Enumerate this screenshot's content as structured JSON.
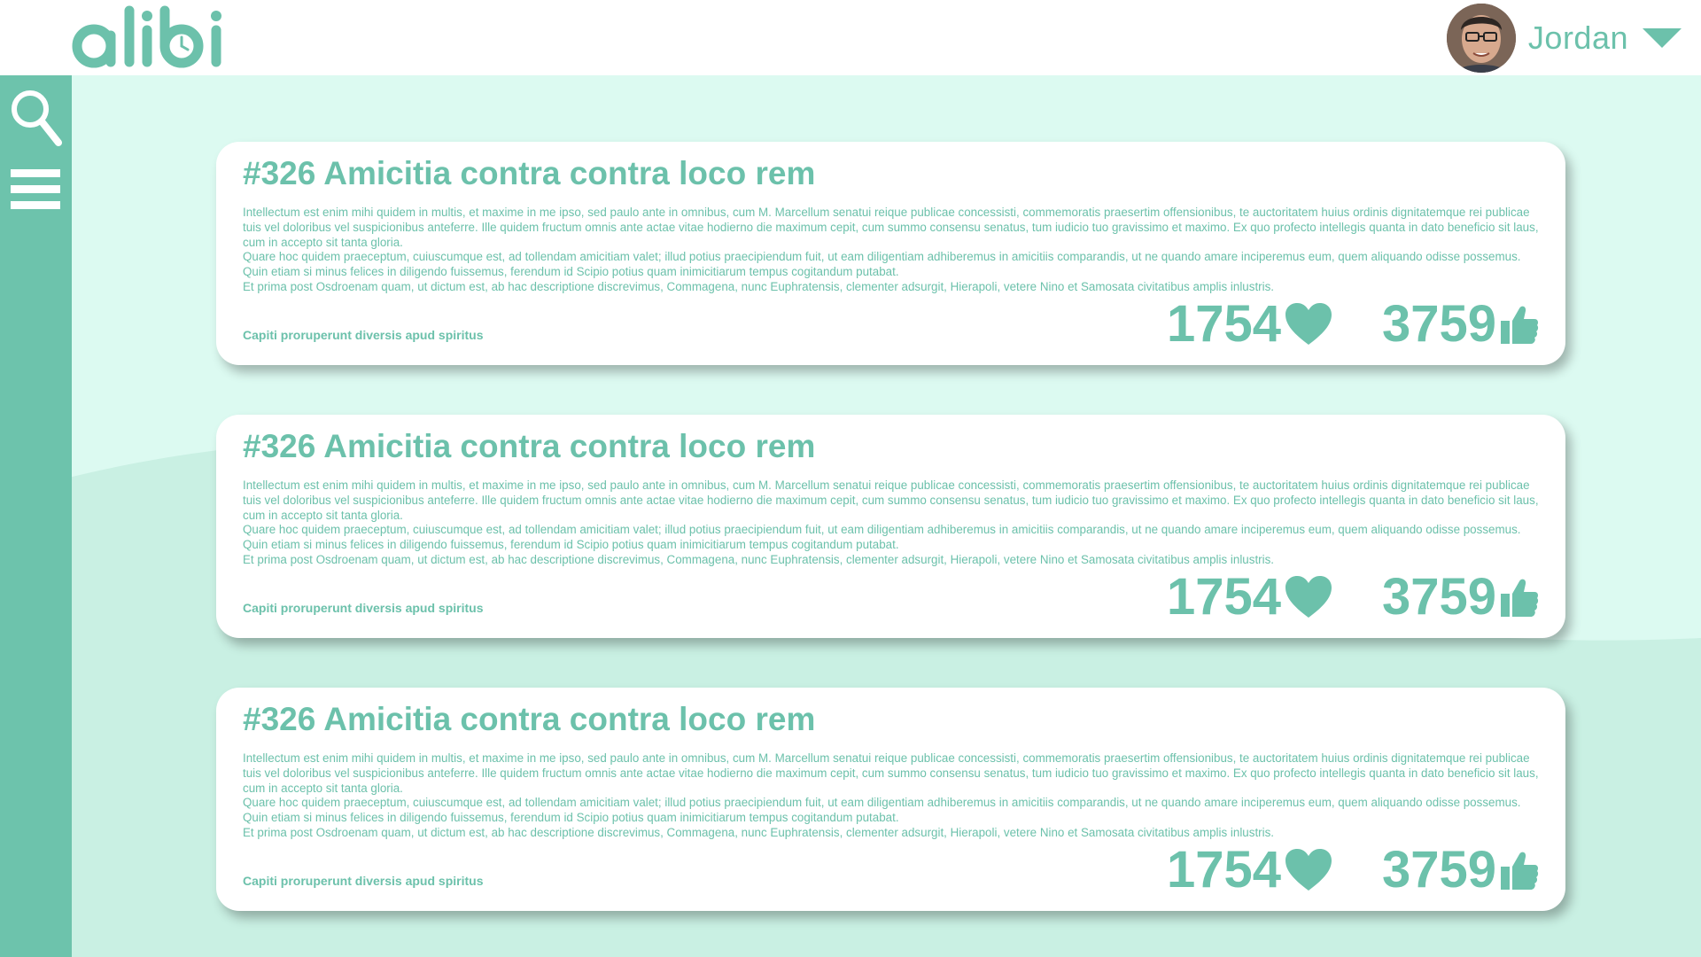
{
  "colors": {
    "accent": "#6cc1ab",
    "sidebar": "#6dc3ac",
    "background": "#dcfaf1",
    "card": "#ffffff"
  },
  "header": {
    "logo_text": "alibi",
    "user": {
      "name": "Jordan",
      "avatar_icon": "user-avatar",
      "menu_icon": "chevron-down-icon"
    }
  },
  "sidebar": {
    "icons": [
      "search-icon",
      "menu-icon"
    ]
  },
  "cards": [
    {
      "title": "#326 Amicitia contra contra loco rem",
      "paragraphs": [
        "Intellectum est enim mihi quidem in multis, et maxime in me ipso, sed paulo ante in omnibus, cum M. Marcellum senatui reique publicae concessisti, commemoratis praesertim offensionibus, te auctoritatem huius ordinis dignitatemque rei publicae tuis vel doloribus vel suspicionibus anteferre. Ille quidem fructum omnis ante actae vitae hodierno die maximum cepit, cum summo consensu senatus, tum iudicio tuo gravissimo et maximo. Ex quo profecto intellegis quanta in dato beneficio sit laus, cum in accepto sit tanta gloria.",
        "Quare hoc quidem praeceptum, cuiuscumque est, ad tollendam amicitiam valet; illud potius praecipiendum fuit, ut eam diligentiam adhiberemus in amicitiis comparandis, ut ne quando amare inciperemus eum, quem aliquando odisse possemus. Quin etiam si minus felices in diligendo fuissemus, ferendum id Scipio potius quam inimicitiarum tempus cogitandum putabat.",
        "Et prima post Osdroenam quam, ut dictum est, ab hac descriptione discrevimus, Commagena, nunc Euphratensis, clementer adsurgit, Hierapoli, vetere Nino et Samosata civitatibus amplis inlustris."
      ],
      "tag": "Capiti proruperunt diversis apud spiritus",
      "hearts": "1754",
      "likes": "3759"
    },
    {
      "title": "#326 Amicitia contra contra loco rem",
      "paragraphs": [
        "Intellectum est enim mihi quidem in multis, et maxime in me ipso, sed paulo ante in omnibus, cum M. Marcellum senatui reique publicae concessisti, commemoratis praesertim offensionibus, te auctoritatem huius ordinis dignitatemque rei publicae tuis vel doloribus vel suspicionibus anteferre. Ille quidem fructum omnis ante actae vitae hodierno die maximum cepit, cum summo consensu senatus, tum iudicio tuo gravissimo et maximo. Ex quo profecto intellegis quanta in dato beneficio sit laus, cum in accepto sit tanta gloria.",
        "Quare hoc quidem praeceptum, cuiuscumque est, ad tollendam amicitiam valet; illud potius praecipiendum fuit, ut eam diligentiam adhiberemus in amicitiis comparandis, ut ne quando amare inciperemus eum, quem aliquando odisse possemus. Quin etiam si minus felices in diligendo fuissemus, ferendum id Scipio potius quam inimicitiarum tempus cogitandum putabat.",
        "Et prima post Osdroenam quam, ut dictum est, ab hac descriptione discrevimus, Commagena, nunc Euphratensis, clementer adsurgit, Hierapoli, vetere Nino et Samosata civitatibus amplis inlustris."
      ],
      "tag": "Capiti proruperunt diversis apud spiritus",
      "hearts": "1754",
      "likes": "3759"
    },
    {
      "title": "#326 Amicitia contra contra loco rem",
      "paragraphs": [
        "Intellectum est enim mihi quidem in multis, et maxime in me ipso, sed paulo ante in omnibus, cum M. Marcellum senatui reique publicae concessisti, commemoratis praesertim offensionibus, te auctoritatem huius ordinis dignitatemque rei publicae tuis vel doloribus vel suspicionibus anteferre. Ille quidem fructum omnis ante actae vitae hodierno die maximum cepit, cum summo consensu senatus, tum iudicio tuo gravissimo et maximo. Ex quo profecto intellegis quanta in dato beneficio sit laus, cum in accepto sit tanta gloria.",
        "Quare hoc quidem praeceptum, cuiuscumque est, ad tollendam amicitiam valet; illud potius praecipiendum fuit, ut eam diligentiam adhiberemus in amicitiis comparandis, ut ne quando amare inciperemus eum, quem aliquando odisse possemus. Quin etiam si minus felices in diligendo fuissemus, ferendum id Scipio potius quam inimicitiarum tempus cogitandum putabat.",
        "Et prima post Osdroenam quam, ut dictum est, ab hac descriptione discrevimus, Commagena, nunc Euphratensis, clementer adsurgit, Hierapoli, vetere Nino et Samosata civitatibus amplis inlustris."
      ],
      "tag": "Capiti proruperunt diversis apud spiritus",
      "hearts": "1754",
      "likes": "3759"
    }
  ]
}
